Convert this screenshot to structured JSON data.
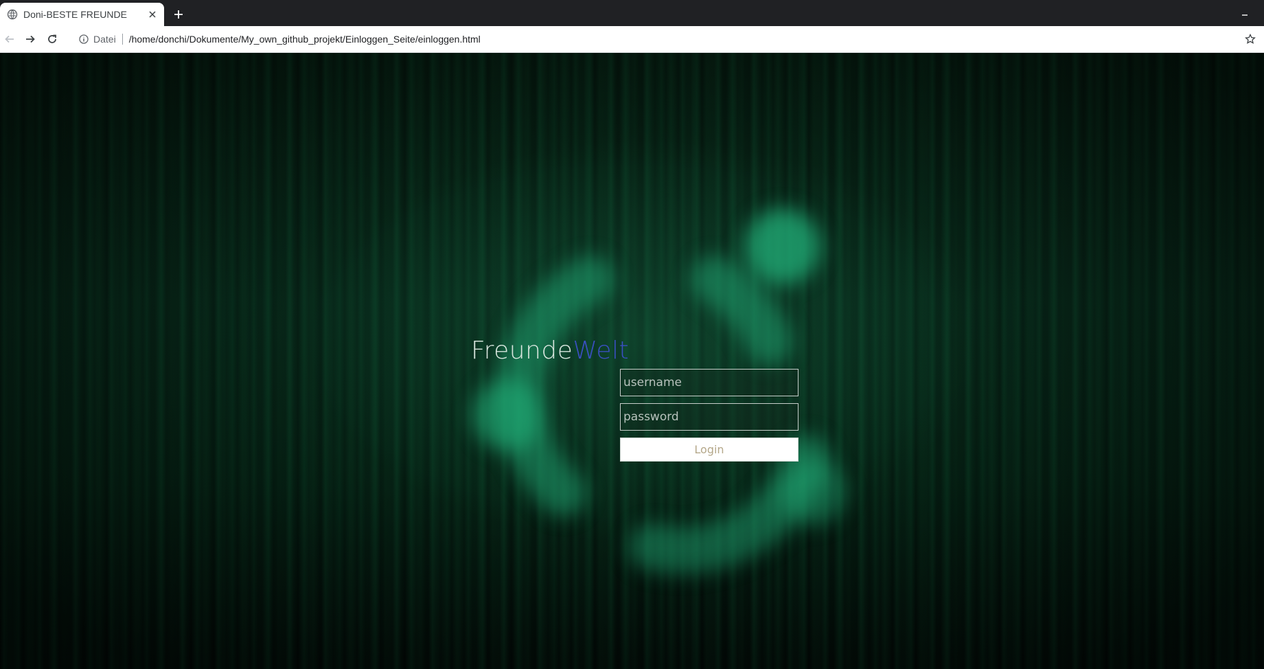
{
  "browser": {
    "tab": {
      "title": "Doni-BESTE FREUNDE",
      "favicon": "globe-icon"
    },
    "toolbar": {
      "scheme_label": "Datei",
      "url": "/home/donchi/Dokumente/My_own_github_projekt/Einloggen_Seite/einloggen.html"
    }
  },
  "page": {
    "brand": {
      "part1": "Freunde",
      "part2": "Welt",
      "part1_color": "#d8e6de",
      "part2_color": "#3a4fc0"
    },
    "login_form": {
      "username_placeholder": "username",
      "username_value": "",
      "password_placeholder": "password",
      "password_value": "",
      "submit_label": "Login"
    },
    "background": {
      "theme": "green matrix code with blurred Ubuntu-style logo",
      "accent": "#1fa070"
    }
  }
}
